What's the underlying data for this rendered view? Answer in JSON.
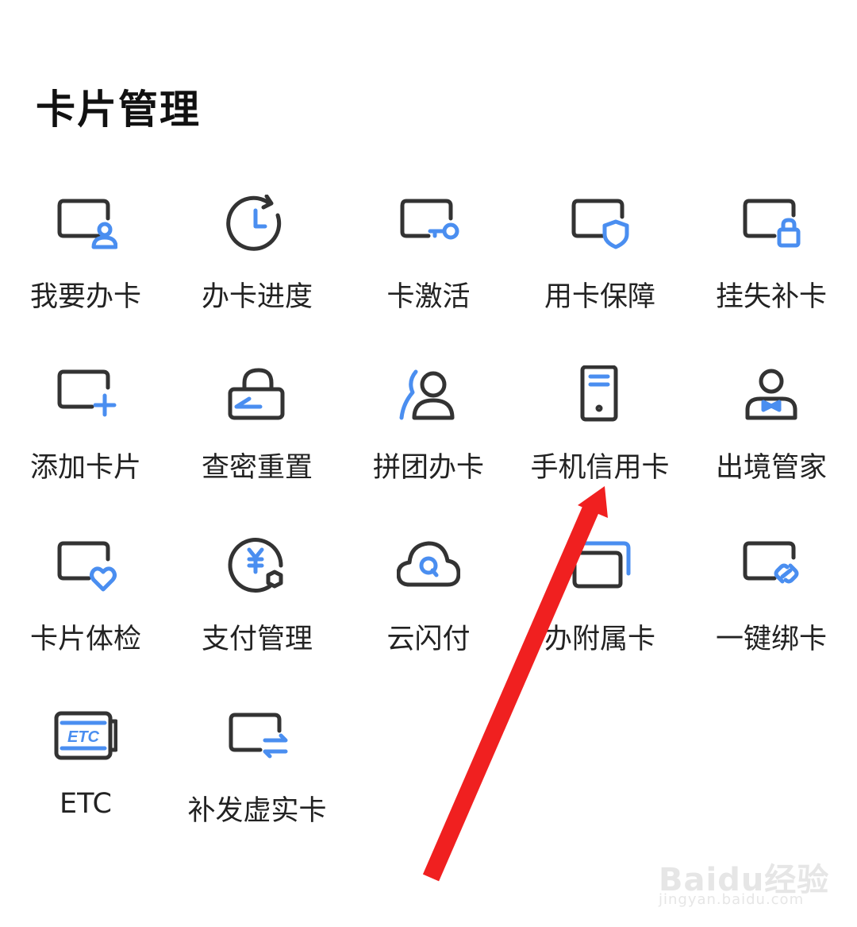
{
  "section_title": "卡片管理",
  "accent_color": "#4a8ef0",
  "icon_stroke_color": "#333333",
  "items": [
    {
      "label": "我要办卡",
      "icon": "card-user-icon"
    },
    {
      "label": "办卡进度",
      "icon": "clock-refresh-icon"
    },
    {
      "label": "卡激活",
      "icon": "card-key-icon"
    },
    {
      "label": "用卡保障",
      "icon": "card-shield-icon"
    },
    {
      "label": "挂失补卡",
      "icon": "card-lock-icon"
    },
    {
      "label": "添加卡片",
      "icon": "card-plus-icon"
    },
    {
      "label": "查密重置",
      "icon": "unlock-arrow-icon"
    },
    {
      "label": "拼团办卡",
      "icon": "group-user-icon"
    },
    {
      "label": "手机信用卡",
      "icon": "phone-card-icon"
    },
    {
      "label": "出境管家",
      "icon": "butler-icon"
    },
    {
      "label": "卡片体检",
      "icon": "card-heart-icon"
    },
    {
      "label": "支付管理",
      "icon": "yuan-settings-icon"
    },
    {
      "label": "云闪付",
      "icon": "cloud-q-icon"
    },
    {
      "label": "办附属卡",
      "icon": "stacked-cards-icon"
    },
    {
      "label": "一键绑卡",
      "icon": "card-link-icon"
    },
    {
      "label": "ETC",
      "icon": "etc-card-icon"
    },
    {
      "label": "补发虚实卡",
      "icon": "card-exchange-icon"
    }
  ],
  "watermark": {
    "logo": "Baidu经验",
    "url": "jingyan.baidu.com"
  }
}
